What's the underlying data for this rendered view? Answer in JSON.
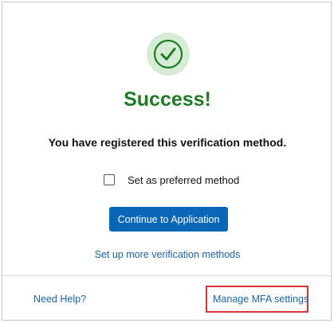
{
  "success": {
    "icon": "check-circle-icon",
    "title": "Success!",
    "message": "You have registered this verification method."
  },
  "preferred": {
    "label": "Set as preferred method",
    "checked": false
  },
  "actions": {
    "continue_label": "Continue to Application",
    "more_methods_label": "Set up more verification methods"
  },
  "footer": {
    "need_help_label": "Need Help?",
    "manage_mfa_label": "Manage MFA settings"
  },
  "colors": {
    "success_green": "#1e7c22",
    "icon_bg": "#d6ecd6",
    "primary_button": "#0a66b6",
    "link": "#1565b0",
    "highlight": "#e0303a"
  }
}
